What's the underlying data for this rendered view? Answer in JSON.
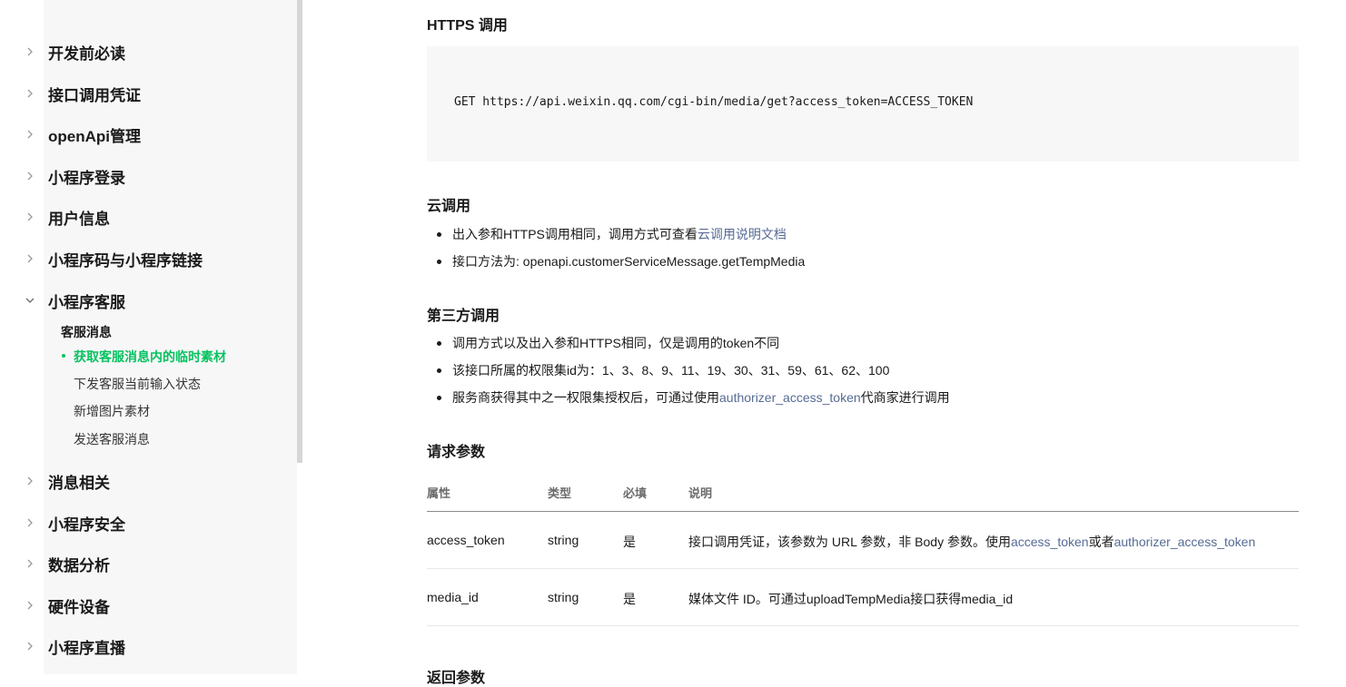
{
  "sidebar": {
    "items_top": [
      {
        "label": "开发前必读"
      },
      {
        "label": "接口调用凭证"
      },
      {
        "label": "openApi管理"
      },
      {
        "label": "小程序登录"
      },
      {
        "label": "用户信息"
      },
      {
        "label": "小程序码与小程序链接"
      },
      {
        "label": "小程序客服"
      }
    ],
    "group_label": "客服消息",
    "sub_items": [
      {
        "label": "获取客服消息内的临时素材",
        "active": true
      },
      {
        "label": "下发客服当前输入状态"
      },
      {
        "label": "新增图片素材"
      },
      {
        "label": "发送客服消息"
      }
    ],
    "items_bottom": [
      {
        "label": "消息相关"
      },
      {
        "label": "小程序安全"
      },
      {
        "label": "数据分析"
      },
      {
        "label": "硬件设备"
      },
      {
        "label": "小程序直播"
      }
    ]
  },
  "content": {
    "https_heading": "HTTPS 调用",
    "request_line": "GET https://api.weixin.qq.com/cgi-bin/media/get?access_token=ACCESS_TOKEN",
    "cloud_heading": "云调用",
    "cloud_b1_text": "出入参和HTTPS调用相同，调用方式可查看",
    "cloud_b1_link": "云调用说明文档",
    "cloud_b2_text": "接口方法为: openapi.customerServiceMessage.getTempMedia",
    "third_heading": "第三方调用",
    "third_b1": "调用方式以及出入参和HTTPS相同，仅是调用的token不同",
    "third_b2": "该接口所属的权限集id为：1、3、8、9、11、19、30、31、59、61、62、100",
    "third_b3_pre": "服务商获得其中之一权限集授权后，可通过使用",
    "third_b3_link": "authorizer_access_token",
    "third_b3_post": "代商家进行调用",
    "params_heading": "请求参数",
    "table": {
      "headers": [
        "属性",
        "类型",
        "必填",
        "说明"
      ],
      "rows": [
        {
          "name": "access_token",
          "type": "string",
          "required": "是",
          "desc_pre": "接口调用凭证，该参数为 URL 参数，非 Body 参数。使用",
          "desc_link1": "access_token",
          "desc_mid": "或者",
          "desc_link2": "authorizer_access_token"
        },
        {
          "name": "media_id",
          "type": "string",
          "required": "是",
          "desc": "媒体文件 ID。可通过uploadTempMedia接口获得media_id"
        }
      ]
    },
    "return_heading": "返回参数"
  }
}
